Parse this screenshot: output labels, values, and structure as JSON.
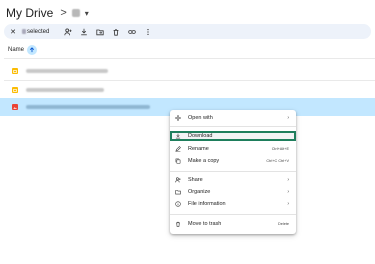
{
  "breadcrumb": {
    "title": "My Drive",
    "separator": ">",
    "folder_caret": "▾"
  },
  "selection_bar": {
    "close": "✕",
    "label": "selected",
    "actions": [
      "share-person-icon",
      "download-icon",
      "move-folder-icon",
      "trash-icon",
      "link-icon",
      "more-vert-icon"
    ]
  },
  "list": {
    "column_name": "Name",
    "sort_arrow": "↑",
    "rows": [
      {
        "type": "slides",
        "color": "#fbbc04",
        "selected": false
      },
      {
        "type": "slides",
        "color": "#fbbc04",
        "selected": false
      },
      {
        "type": "image",
        "color": "#ea4335",
        "selected": true
      }
    ]
  },
  "context_menu": {
    "open_with": "Open with",
    "download": "Download",
    "rename": "Rename",
    "rename_shortcut": "Ctrl+Alt+E",
    "make_copy": "Make a copy",
    "make_copy_shortcut": "Ctrl+C Ctrl+V",
    "share": "Share",
    "organize": "Organize",
    "file_information": "File information",
    "move_to_trash": "Move to trash",
    "move_to_trash_shortcut": "Delete",
    "submenu_arrow": "›"
  },
  "colors": {
    "accent": "#c2e7ff",
    "highlight_outline": "#1e7e5c",
    "toolbar_bg": "#edf2fa"
  }
}
